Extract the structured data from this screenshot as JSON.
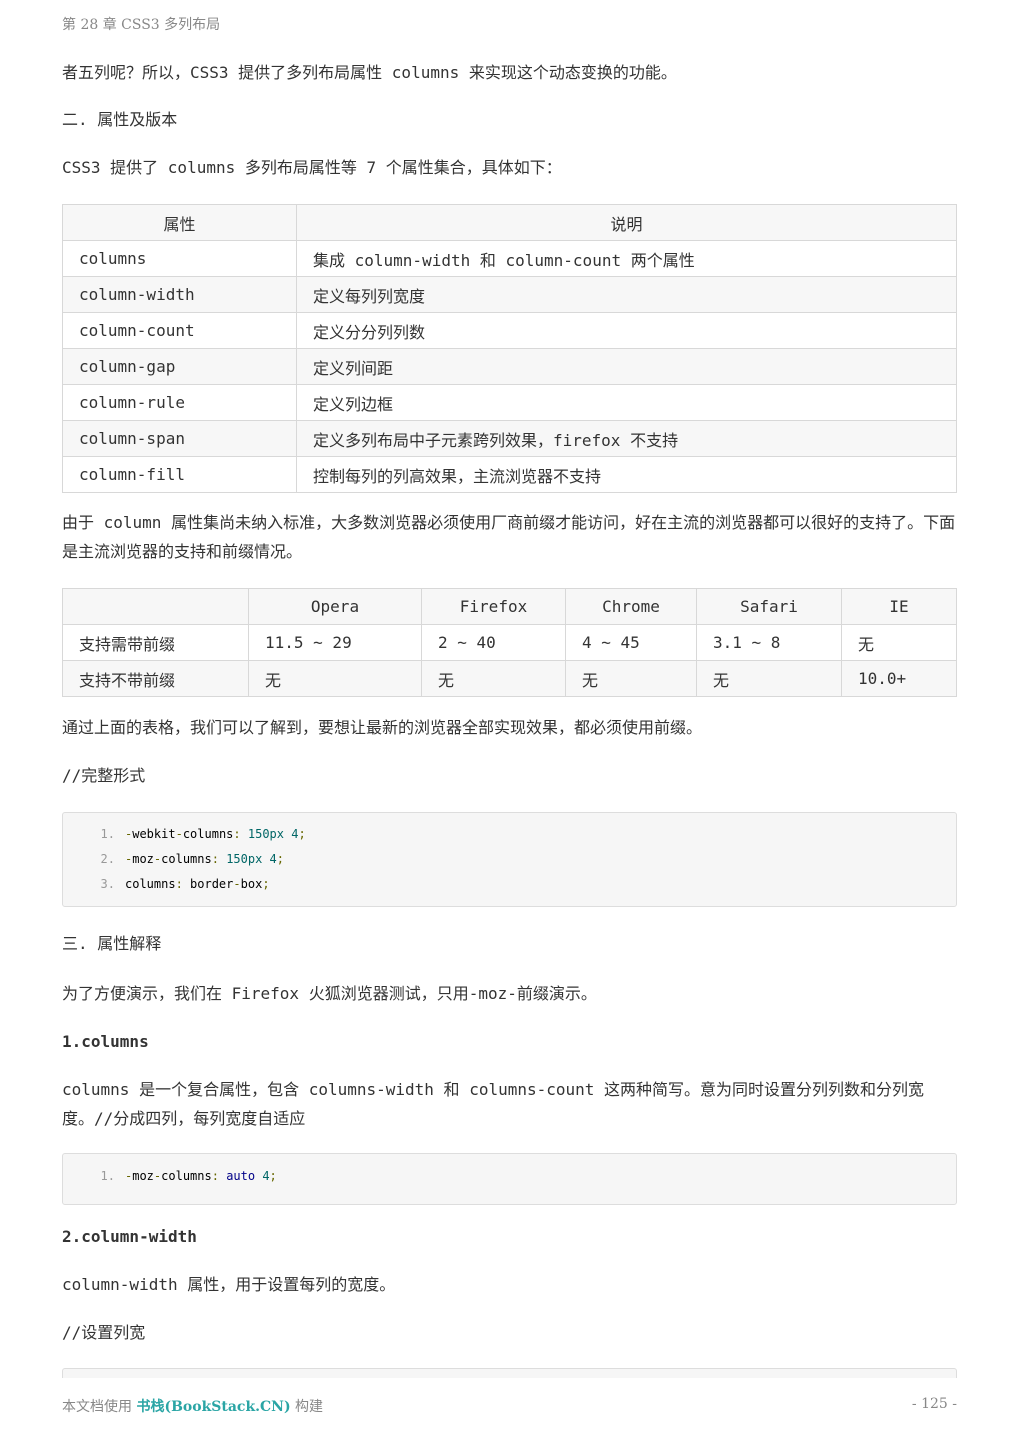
{
  "header": {
    "chapter": "第 28 章 CSS3 多列布局"
  },
  "paragraphs": {
    "p1": "者五列呢？所以，CSS3 提供了多列布局属性 columns 来实现这个动态变换的功能。",
    "h_two": "二. 属性及版本",
    "p2": "CSS3 提供了 columns 多列布局属性等 7 个属性集合，具体如下：",
    "p3": "由于 column 属性集尚未纳入标准，大多数浏览器必须使用厂商前缀才能访问，好在主流的浏览器都可以很好的支持了。下面是主流浏览器的支持和前缀情况。",
    "p4": "通过上面的表格，我们可以了解到，要想让最新的浏览器全部实现效果，都必须使用前缀。",
    "p5": "//完整形式",
    "h_three": "三. 属性解释",
    "p6": "为了方便演示，我们在 Firefox 火狐浏览器测试，只用-moz-前缀演示。",
    "h_columns": "1.columns",
    "p7": "columns 是一个复合属性，包含 columns-width 和 columns-count 这两种简写。意为同时设置分列列数和分列宽度。//分成四列，每列宽度自适应",
    "h_column_width": "2.column-width",
    "p8": "column-width 属性，用于设置每列的宽度。",
    "p9": "//设置列宽"
  },
  "props_table": {
    "headers": [
      "属性",
      "说明"
    ],
    "rows": [
      [
        "columns",
        "集成 column-width 和 column-count 两个属性"
      ],
      [
        "column-width",
        "定义每列列宽度"
      ],
      [
        "column-count",
        "定义分分列列数"
      ],
      [
        "column-gap",
        "定义列间距"
      ],
      [
        "column-rule",
        "定义列边框"
      ],
      [
        "column-span",
        "定义多列布局中子元素跨列效果，firefox 不支持"
      ],
      [
        "column-fill",
        "控制每列的列高效果，主流浏览器不支持"
      ]
    ]
  },
  "browser_table": {
    "headers": [
      "",
      "Opera",
      "Firefox",
      "Chrome",
      "Safari",
      "IE"
    ],
    "rows": [
      [
        "支持需带前缀",
        "11.5 ~ 29",
        "2 ~ 40",
        "4 ~ 45",
        "3.1 ~ 8",
        "无"
      ],
      [
        "支持不带前缀",
        "无",
        "无",
        "无",
        "无",
        "10.0+"
      ]
    ]
  },
  "code1": {
    "lines": [
      {
        "n": "1.",
        "prefix": "-",
        "a": "webkit",
        "b": "-",
        "c": "columns",
        "colon": ":",
        "val": " 150px",
        "num": " 4",
        "semi": ";"
      },
      {
        "n": "2.",
        "prefix": "-",
        "a": "moz",
        "b": "-",
        "c": "columns",
        "colon": ":",
        "val": " 150px",
        "num": " 4",
        "semi": ";"
      },
      {
        "n": "3.",
        "a": "columns",
        "colon": ":",
        "v1": " border",
        "dash": "-",
        "v2": "box",
        "semi": ";"
      }
    ]
  },
  "code2": {
    "lines": [
      {
        "n": "1.",
        "prefix": "-",
        "a": "moz",
        "b": "-",
        "c": "columns",
        "colon": ":",
        "kw": " auto",
        "num": " 4",
        "semi": ";"
      }
    ]
  },
  "footer": {
    "left_pre": "本文档使用 ",
    "brand": "书栈(BookStack.CN)",
    "left_post": " 构建",
    "page": "- 125 -"
  },
  "colors": {
    "link": "#2aa5a5",
    "code_bg": "#f6f6f6",
    "table_stripe": "#f7f7f7"
  }
}
